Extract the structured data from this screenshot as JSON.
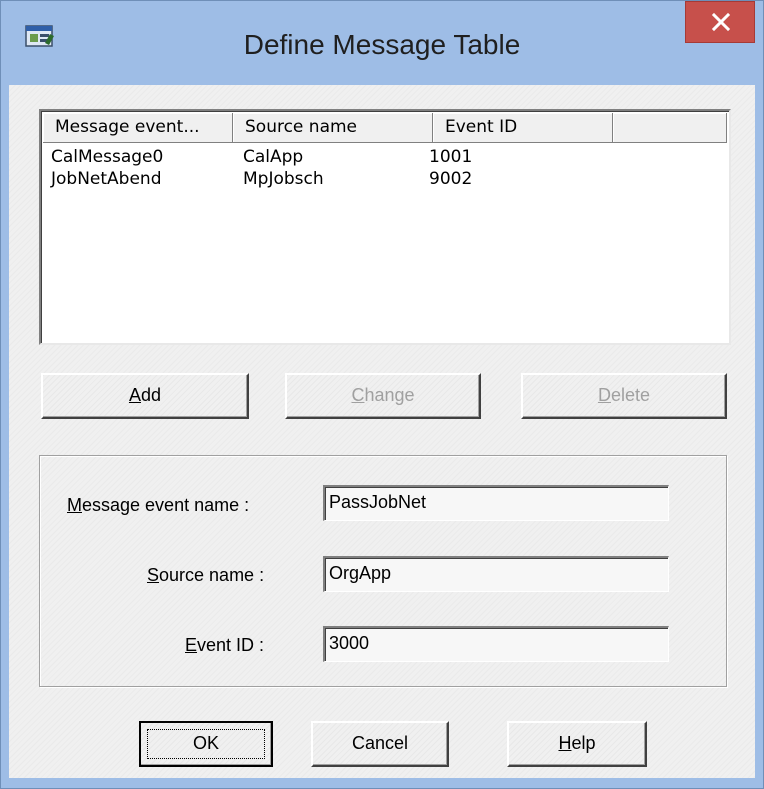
{
  "window": {
    "title": "Define Message Table",
    "icon": "app-window-icon",
    "close_icon": "close-icon",
    "accent": "#9ebde6",
    "close_color": "#c7504b"
  },
  "list": {
    "columns": [
      "Message event...",
      "Source name",
      "Event ID",
      ""
    ],
    "rows": [
      [
        "CalMessage0",
        "CalApp",
        "1001"
      ],
      [
        "JobNetAbend",
        "MpJobsch",
        "9002"
      ]
    ]
  },
  "list_buttons": {
    "add": {
      "pre": "",
      "key": "A",
      "post": "dd"
    },
    "change": {
      "pre": "",
      "key": "C",
      "post": "hange"
    },
    "delete": {
      "pre": "",
      "key": "D",
      "post": "elete"
    }
  },
  "form": {
    "event_name_label": {
      "pre": "",
      "key": "M",
      "post": "essage event name :"
    },
    "event_name_value": "PassJobNet",
    "source_label": {
      "pre": "",
      "key": "S",
      "post": "ource name :"
    },
    "source_value": "OrgApp",
    "event_id_label": {
      "pre": "",
      "key": "E",
      "post": "vent ID :"
    },
    "event_id_value": "3000"
  },
  "footer": {
    "ok": "OK",
    "cancel": "Cancel",
    "help": {
      "pre": "",
      "key": "H",
      "post": "elp"
    }
  }
}
